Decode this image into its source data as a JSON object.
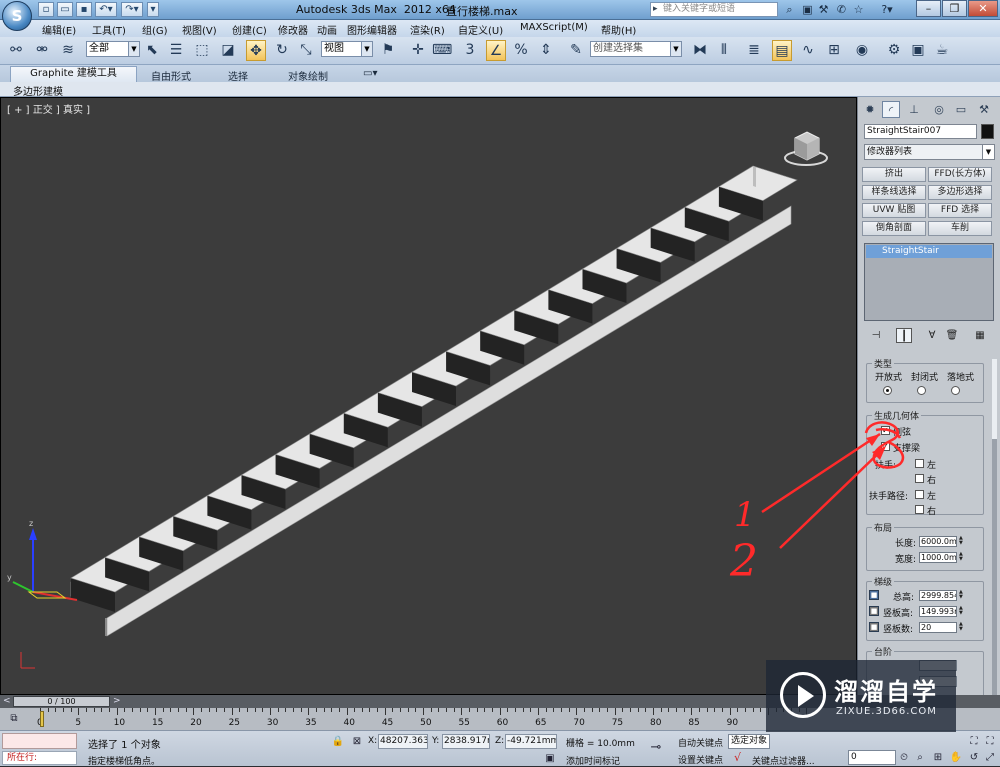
{
  "titlebar": {
    "app_title": "Autodesk 3ds Max  2012 x64",
    "file_name": "直行楼梯.max",
    "search_placeholder": "键入关键字或短语",
    "logo_glyph": "S"
  },
  "menu": {
    "items": [
      "编辑(E)",
      "工具(T)",
      "组(G)",
      "视图(V)",
      "创建(C)",
      "修改器",
      "动画",
      "图形编辑器",
      "渲染(R)",
      "自定义(U)",
      "MAXScript(M)",
      "帮助(H)"
    ]
  },
  "toolbar": {
    "selection_filter": "全部",
    "reference_coord": "视图",
    "named_selection": "创建选择集",
    "snap_count": "3",
    "percent_snap": "%"
  },
  "ribbon": {
    "tabs": [
      "Graphite 建模工具",
      "自由形式",
      "选择",
      "对象绘制"
    ],
    "sub_label": "多边形建模"
  },
  "viewport": {
    "label": "[ + ] 正交 ] 真实 ]"
  },
  "command_panel": {
    "object_name": "StraightStair007",
    "modifier_list": "修改器列表",
    "modifier_buttons": [
      "挤出",
      "FFD(长方体)",
      "样条线选择",
      "多边形选择",
      "UVW 贴图",
      "FFD 选择",
      "倒角剖面",
      "车削"
    ],
    "stack_item": "StraightStair",
    "type_group": {
      "title": "类型",
      "options": [
        "开放式",
        "封闭式",
        "落地式"
      ],
      "selected": 0
    },
    "geometry_group": {
      "title": "生成几何体",
      "side_chord": "侧弦",
      "support_beam": "支撑梁",
      "handrail": "扶手:",
      "handrail_path": "扶手路径:",
      "left": "左",
      "right": "右"
    },
    "layout_group": {
      "title": "布局",
      "length_label": "长度:",
      "length_value": "6000.0mm",
      "width_label": "宽度:",
      "width_value": "1000.0mm"
    },
    "steps_group": {
      "title": "梯级",
      "overall_label": "总高:",
      "overall_value": "2999.854",
      "riser_ht_label": "竖板高:",
      "riser_ht_value": "149.993m",
      "riser_ct_label": "竖板数:",
      "riser_ct_value": "20"
    },
    "stair_group_title": "台阶"
  },
  "timeline": {
    "frame_display": "0 / 100",
    "ticks": [
      0,
      5,
      10,
      15,
      20,
      25,
      30,
      35,
      40,
      45,
      50,
      55,
      60,
      65,
      70,
      75,
      80,
      85,
      90
    ]
  },
  "status": {
    "running": "所在行:",
    "selection_msg": "选择了 1 个对象",
    "prompt_msg": "指定楼梯低角点。",
    "x_label": "X:",
    "x_value": "48207.363",
    "y_label": "Y:",
    "y_value": "2838.917m",
    "z_label": "Z:",
    "z_value": "-49.721mm",
    "grid_label": "栅格 = 10.0mm",
    "auto_key": "自动关键点",
    "set_key": "设置关键点",
    "key_mode": "选定对象",
    "add_time_tag": "添加时间标记",
    "key_filters": "关键点过滤器...",
    "frame_value": "0"
  },
  "watermark": {
    "title": "溜溜自学",
    "url": "ZIXUE.3D66.COM"
  },
  "annotation": {
    "number_one": "1",
    "number_two": "2"
  },
  "colors": {
    "viewport_bg": "#3c3c3c",
    "stair_face": "#e6e6e6",
    "annotation_red": "#ff2a2a",
    "highlight_blue": "#6fa0d8"
  }
}
